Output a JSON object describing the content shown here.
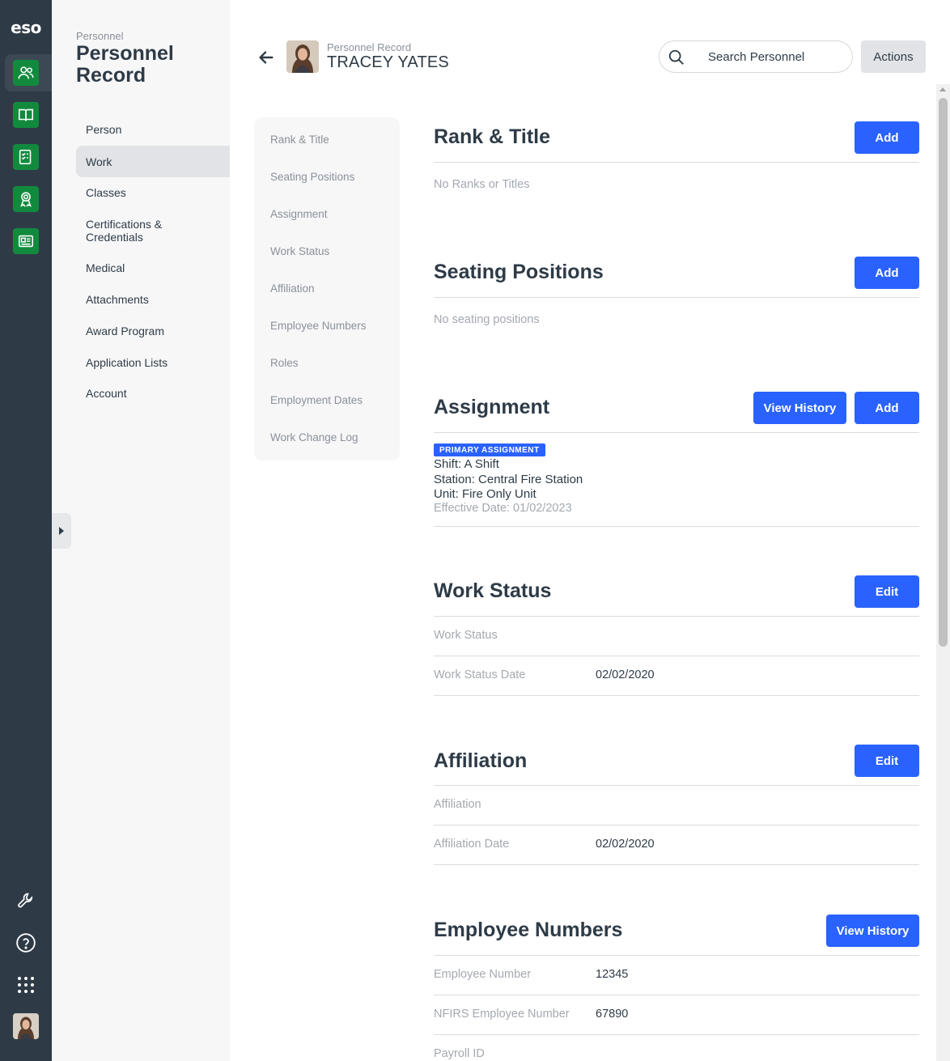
{
  "app": {
    "logo_text": "eso",
    "nav_icons": [
      "people-icon",
      "book-icon",
      "checklist-icon",
      "award-icon",
      "newspaper-icon"
    ],
    "bottom_icons": [
      "wrench-icon",
      "help-icon",
      "apps-grid-icon"
    ]
  },
  "subnav": {
    "crumb": "Personnel",
    "title": "Personnel Record",
    "items": [
      {
        "label": "Person"
      },
      {
        "label": "Work"
      },
      {
        "label": "Classes"
      },
      {
        "label": "Certifications & Credentials"
      },
      {
        "label": "Medical"
      },
      {
        "label": "Attachments"
      },
      {
        "label": "Award Program"
      },
      {
        "label": "Application Lists"
      },
      {
        "label": "Account"
      }
    ],
    "active_item": "Work"
  },
  "header": {
    "crumb": "Personnel Record",
    "name": "TRACEY YATES",
    "search_placeholder": "Search Personnel",
    "actions_label": "Actions"
  },
  "toc": {
    "items": [
      "Rank & Title",
      "Seating Positions",
      "Assignment",
      "Work Status",
      "Affiliation",
      "Employee Numbers",
      "Roles",
      "Employment Dates",
      "Work Change Log"
    ]
  },
  "sections": {
    "rank_title": {
      "title": "Rank & Title",
      "add_label": "Add",
      "empty": "No Ranks or Titles"
    },
    "seating": {
      "title": "Seating Positions",
      "add_label": "Add",
      "empty": "No seating positions"
    },
    "assignment": {
      "title": "Assignment",
      "history_label": "View History",
      "add_label": "Add",
      "badge": "PRIMARY ASSIGNMENT",
      "shift": "Shift: A Shift",
      "station": "Station: Central Fire Station",
      "unit": "Unit: Fire Only Unit",
      "effective": "Effective Date: 01/02/2023"
    },
    "work_status": {
      "title": "Work Status",
      "edit_label": "Edit",
      "rows": [
        {
          "label": "Work Status",
          "value": ""
        },
        {
          "label": "Work Status Date",
          "value": "02/02/2020"
        }
      ]
    },
    "affiliation": {
      "title": "Affiliation",
      "edit_label": "Edit",
      "rows": [
        {
          "label": "Affiliation",
          "value": ""
        },
        {
          "label": "Affiliation Date",
          "value": "02/02/2020"
        }
      ]
    },
    "employee_numbers": {
      "title": "Employee Numbers",
      "history_label": "View History",
      "rows": [
        {
          "label": "Employee Number",
          "value": "12345"
        },
        {
          "label": "NFIRS Employee Number",
          "value": "67890"
        },
        {
          "label": "Payroll ID",
          "value": ""
        }
      ]
    }
  },
  "colors": {
    "rail": "#2e3b47",
    "rail_icon": "#128a3e",
    "primary": "#2962ff"
  }
}
